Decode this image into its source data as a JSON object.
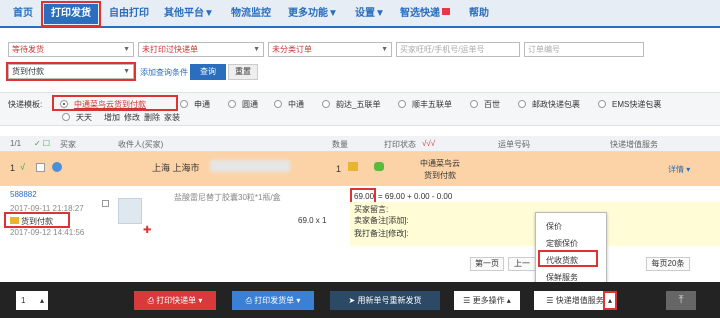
{
  "nav": {
    "items": [
      "首页",
      "打印发货",
      "自由打印",
      "其他平台▼",
      "物流监控",
      "更多功能▼",
      "设置▼",
      "智选快递",
      "帮助"
    ]
  },
  "filters": {
    "ship_status": "等待发货",
    "print_status": "未打印过快递单",
    "order_type": "未分类订单",
    "buyer_placeholder": "买家旺旺/手机号/运单号",
    "order_no_placeholder": "订单编号",
    "payment": "货到付款",
    "add_condition": "添加查询条件",
    "query": "查询",
    "reset": "重置"
  },
  "template": {
    "label": "快递模板:",
    "options": [
      "中通菜鸟云货到付款",
      "申通",
      "圆通",
      "中通",
      "韵达_五联单",
      "顺丰五联单",
      "百世",
      "邮政快递包裹",
      "EMS快递包裹",
      "天天"
    ],
    "links": [
      "增加",
      "修改",
      "删除",
      "家装"
    ]
  },
  "table_header": {
    "page": "1/1",
    "buyer": "买家",
    "recipient": "收件人(买家)",
    "quantity": "数量",
    "status": "打印状态",
    "tracking": "运单号码",
    "value_added": "快递增值服务"
  },
  "order": {
    "address": "上海 上海市",
    "qty_count": "1",
    "carrier": "中通菜鸟云",
    "payment_tag": "货到付款",
    "detail": "详情",
    "order_no": "588882",
    "time1": "2017-09-11 21:18:27",
    "tag": "货到付款",
    "time2": "2017-09-12 14:41:56",
    "product": "盐酸雷尼替丁胶囊30粒*1瓶/盒",
    "unit_price": "69.0 x 1",
    "amount": "69.00",
    "calc": "= 69.00 + 0.00 - 0.00",
    "buyer_note": "买家留言:",
    "seller_note": "卖家备注[添加]:",
    "my_note": "我打备注[修改]:"
  },
  "pager": {
    "first": "第一页",
    "prev": "上一",
    "per_page": "每页20条"
  },
  "menu": {
    "items": [
      "保价",
      "定额保价",
      "代收货款",
      "保鲜服务"
    ]
  },
  "bottom": {
    "page_num": "1",
    "print_express": "打印快递单",
    "print_ship": "打印发货单",
    "reprint": "用新单号重新发货",
    "more": "更多操作",
    "value_added": "快递增值服务"
  }
}
